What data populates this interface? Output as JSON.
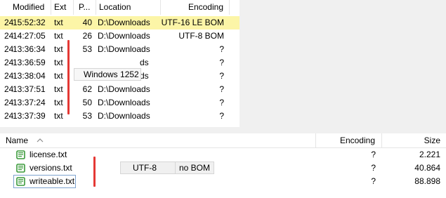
{
  "top": {
    "columns": {
      "modified": "Modified",
      "ext": "Ext",
      "p": "P...",
      "location": "Location",
      "encoding": "Encoding"
    },
    "rows": [
      {
        "date": "24",
        "time": "15:52:32",
        "ext": "txt",
        "p": "40",
        "location": "D:\\Downloads",
        "encoding": "UTF-16 LE BOM",
        "selected": true
      },
      {
        "date": "24",
        "time": "14:27:05",
        "ext": "txt",
        "p": "26",
        "location": "D:\\Downloads",
        "encoding": "UTF-8 BOM",
        "selected": false
      },
      {
        "date": "24",
        "time": "13:36:34",
        "ext": "txt",
        "p": "53",
        "location": "D:\\Downloads",
        "encoding": "?",
        "selected": false
      },
      {
        "date": "24",
        "time": "13:36:59",
        "ext": "txt",
        "p": "",
        "location": "ds",
        "encoding": "?",
        "selected": false
      },
      {
        "date": "24",
        "time": "13:38:04",
        "ext": "txt",
        "p": "",
        "location": "ds",
        "encoding": "?",
        "selected": false
      },
      {
        "date": "24",
        "time": "13:37:51",
        "ext": "txt",
        "p": "62",
        "location": "D:\\Downloads",
        "encoding": "?",
        "selected": false
      },
      {
        "date": "24",
        "time": "13:37:24",
        "ext": "txt",
        "p": "50",
        "location": "D:\\Downloads",
        "encoding": "?",
        "selected": false
      },
      {
        "date": "24",
        "time": "13:37:39",
        "ext": "txt",
        "p": "53",
        "location": "D:\\Downloads",
        "encoding": "?",
        "selected": false
      }
    ],
    "popup_label": "Windows 1252"
  },
  "bottom": {
    "columns": {
      "name": "Name",
      "encoding": "Encoding",
      "size": "Size"
    },
    "rows": [
      {
        "name": "license.txt",
        "encoding": "?",
        "size": "2.221"
      },
      {
        "name": "versions.txt",
        "encoding": "?",
        "size": "40.864"
      },
      {
        "name": "writeable.txt",
        "encoding": "?",
        "size": "88.898"
      }
    ],
    "inline_encoding": {
      "charset": "UTF-8",
      "bom": "no BOM"
    }
  },
  "colors": {
    "selection": "#fcf5a7",
    "annotation": "#e53935",
    "icon_green": "#3a9a3a"
  },
  "icons": {
    "file": "text-file-icon",
    "sort": "sort-ascending-icon"
  }
}
